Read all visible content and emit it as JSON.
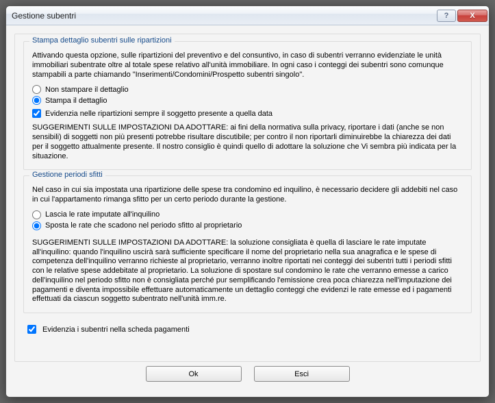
{
  "window": {
    "title": "Gestione subentri",
    "help_symbol": "?",
    "close_symbol": "X"
  },
  "group1": {
    "label": "Stampa dettaglio subentri sulle ripartizioni",
    "intro": "Attivando questa opzione, sulle ripartizioni del preventivo e del consuntivo, in caso di subentri verranno evidenziate le unità immobiliari subentrate oltre al totale spese relativo all'unità immobiliare. In ogni caso i conteggi dei subentri sono comunque stampabili a parte chiamando \"Inserimenti/Condomini/Prospetto subentri singolo\".",
    "radio1": "Non stampare il dettaglio",
    "radio2": "Stampa il dettaglio",
    "check1": "Evidenzia nelle ripartizioni sempre il soggetto presente a quella data",
    "advice_head": "SUGGERIMENTI SULLE IMPOSTAZIONI DA ADOTTARE: ",
    "advice_body": "ai fini della normativa sulla privacy, riportare i dati (anche se non sensibili) di soggetti non più presenti potrebbe risultare discutibile; per contro il non riportarli diminuirebbe la chiarezza dei dati per il soggetto attualmente presente. Il nostro consiglio è quindi quello di adottare la soluzione che Vi sembra più indicata per la situazione."
  },
  "group2": {
    "label": "Gestione periodi sfitti",
    "intro": "Nel caso in cui sia impostata una ripartizione delle spese tra condomino ed inquilino, è necessario decidere gli addebiti nel caso in cui l'appartamento rimanga sfitto per un certo periodo durante la gestione.",
    "radio1": "Lascia le rate imputate all'inquilino",
    "radio2": "Sposta le rate che scadono nel periodo sfitto al proprietario",
    "advice_head": "SUGGERIMENTI SULLE IMPOSTAZIONI DA ADOTTARE: ",
    "advice_body": "la soluzione consigliata è quella di lasciare le rate imputate all'inquilino: quando l'inquilino uscirà sarà sufficiente specificare il nome del proprietario nella sua anagrafica e le spese di competenza dell'inquilino verranno richieste al proprietario, verranno inoltre riportati nei conteggi dei subentri tutti i periodi sfitti con le relative spese addebitate al proprietario. La soluzione di spostare sul condomino le rate che verranno emesse a carico dell'inquilino nel periodo sfitto non è consigliata perché pur semplificando l'emissione crea poca chiarezza nell'imputazione dei pagamenti e diventa impossibile effettuare automaticamente un dettaglio conteggi che evidenzi le rate emesse ed i pagamenti effettuati da ciascun soggetto subentrato nell'unità imm.re."
  },
  "bottom": {
    "check": "Evidenzia i subentri nella scheda pagamenti"
  },
  "buttons": {
    "ok": "Ok",
    "exit": "Esci"
  }
}
